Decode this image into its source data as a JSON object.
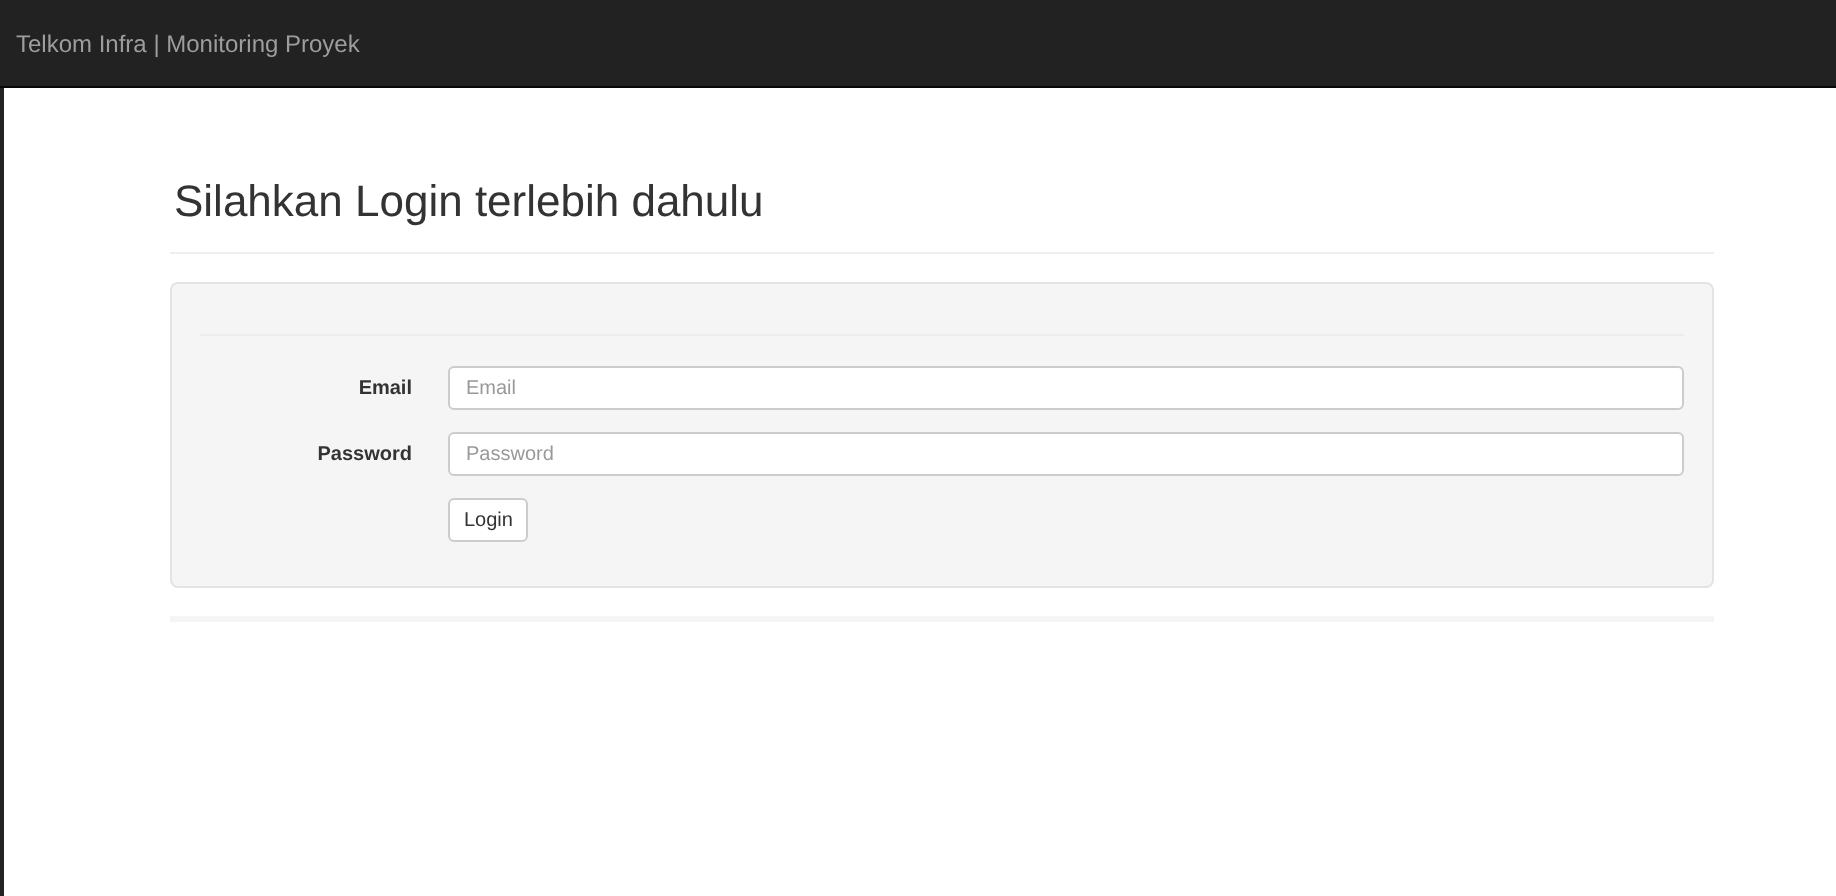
{
  "navbar": {
    "brand": "Telkom Infra | Monitoring Proyek"
  },
  "heading": "Silahkan Login terlebih dahulu",
  "form": {
    "fields": [
      {
        "label": "Email",
        "placeholder": "Email"
      },
      {
        "label": "Password",
        "placeholder": "Password"
      }
    ],
    "submit": "Login"
  }
}
